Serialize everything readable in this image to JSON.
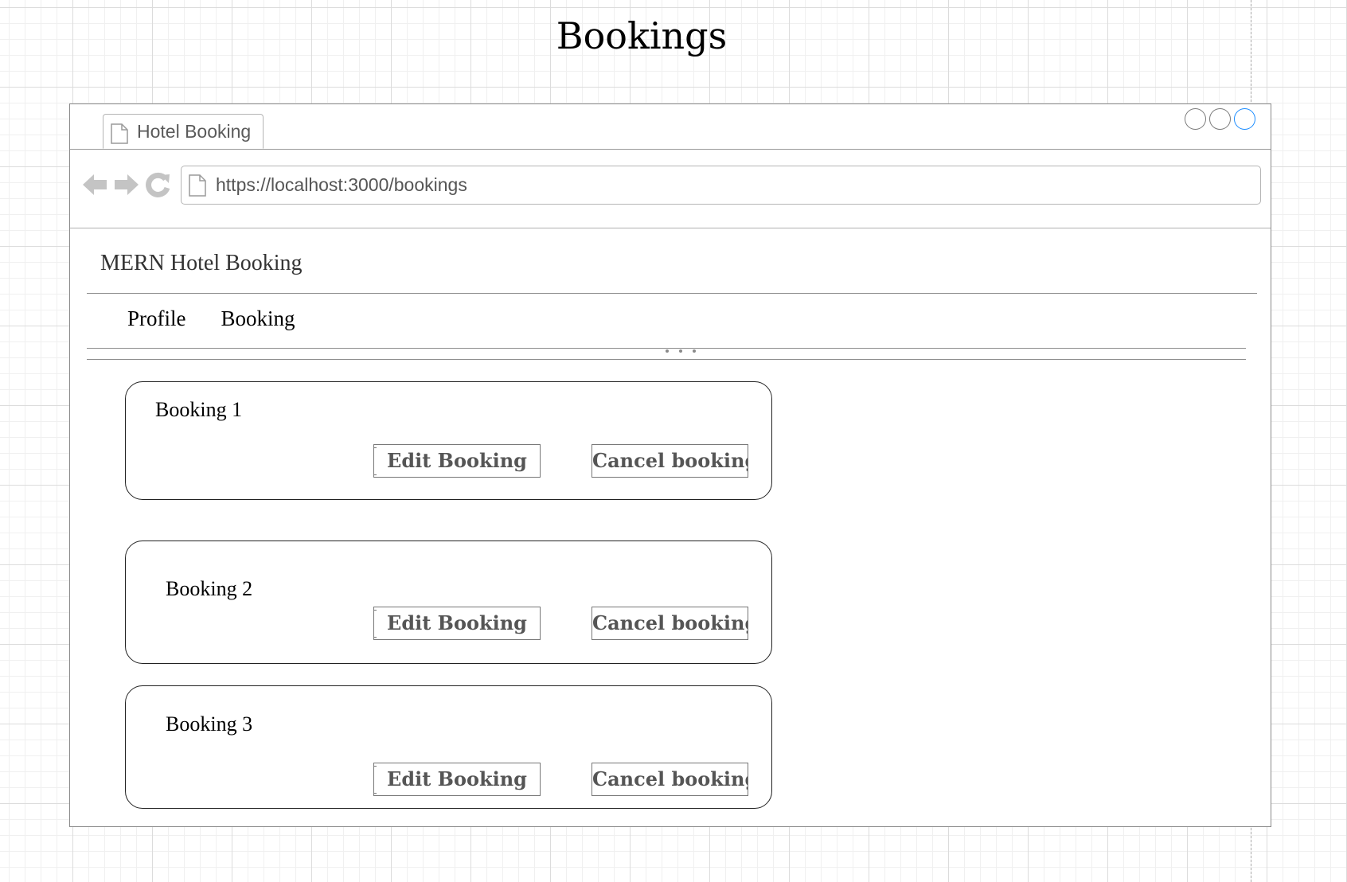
{
  "page": {
    "title": "Bookings"
  },
  "browser": {
    "tab_label": "Hotel Booking",
    "url": "https://localhost:3000/bookings",
    "window_controls": [
      "minimize",
      "maximize",
      "close"
    ],
    "accent_color": "#1a8cff"
  },
  "app": {
    "brand": "MERN Hotel Booking",
    "nav": [
      {
        "label": "Profile"
      },
      {
        "label": "Booking"
      }
    ]
  },
  "bookings": [
    {
      "title": "Booking  1",
      "edit_label": "Edit Booking",
      "cancel_label": "Cancel  booking"
    },
    {
      "title": "Booking  2",
      "edit_label": "Edit Booking",
      "cancel_label": "Cancel  booking"
    },
    {
      "title": "Booking  3",
      "edit_label": "Edit Booking",
      "cancel_label": "Cancel  booking"
    }
  ]
}
